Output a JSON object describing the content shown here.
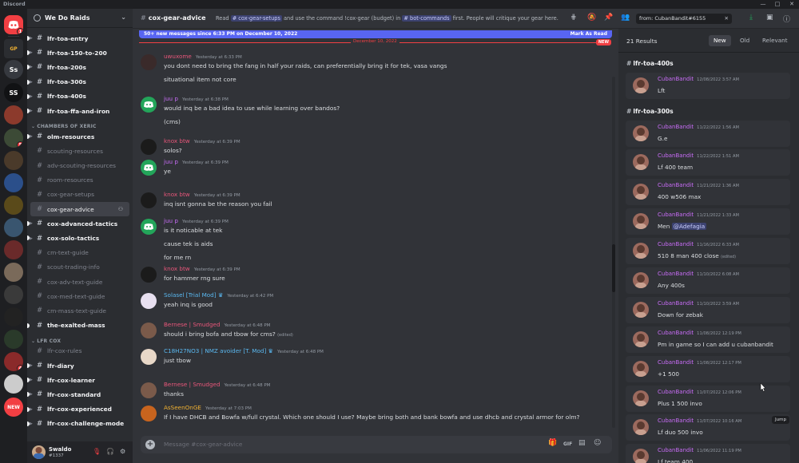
{
  "app": {
    "title": "Discord",
    "window_controls": [
      "—",
      "□",
      "✕"
    ]
  },
  "servers": [
    {
      "label": "",
      "icon": "discord-logo-icon",
      "color": "#f23f43",
      "badge": "1"
    },
    {
      "label": "GP",
      "icon": "gpower-icon",
      "color": "#2b2d31",
      "badge": ""
    },
    {
      "label": "Ss",
      "icon": "",
      "color": "#36393f",
      "badge": ""
    },
    {
      "label": "SS",
      "icon": "",
      "color": "#111214",
      "badge": ""
    },
    {
      "label": "",
      "icon": "",
      "color": "#8c3a2c",
      "badge": ""
    },
    {
      "label": "",
      "icon": "",
      "color": "#3c4a36",
      "badge": "5"
    },
    {
      "label": "",
      "icon": "",
      "color": "#4a3a2a",
      "badge": ""
    },
    {
      "label": "",
      "icon": "",
      "color": "#2b4f8a",
      "badge": ""
    },
    {
      "label": "",
      "icon": "",
      "color": "#5a4a1a",
      "badge": ""
    },
    {
      "label": "",
      "icon": "",
      "color": "#39556f",
      "badge": ""
    },
    {
      "label": "",
      "icon": "",
      "color": "#6a2a2a",
      "badge": ""
    },
    {
      "label": "",
      "icon": "",
      "color": "#7a6a5a",
      "badge": ""
    },
    {
      "label": "",
      "icon": "",
      "color": "#3a3a3a",
      "badge": ""
    },
    {
      "label": "",
      "icon": "",
      "color": "#222",
      "badge": ""
    },
    {
      "label": "",
      "icon": "",
      "color": "#2a3a2a",
      "badge": ""
    },
    {
      "label": "",
      "icon": "",
      "color": "#8a2a2a",
      "badge": "4"
    },
    {
      "label": "",
      "icon": "",
      "color": "#cccccc",
      "badge": ""
    },
    {
      "label": "NEW",
      "icon": "",
      "color": "#f23f43",
      "badge": ""
    }
  ],
  "guild": {
    "name": "We Do Raids"
  },
  "channels": [
    {
      "kind": "channel",
      "name": "lfr-toa-entry",
      "unread": true,
      "active": false,
      "thread": true
    },
    {
      "kind": "channel",
      "name": "lfr-toa-150-to-200",
      "unread": true,
      "active": false,
      "thread": true
    },
    {
      "kind": "channel",
      "name": "lfr-toa-200s",
      "unread": true,
      "active": false,
      "thread": true
    },
    {
      "kind": "channel",
      "name": "lfr-toa-300s",
      "unread": true,
      "active": false,
      "thread": true
    },
    {
      "kind": "channel",
      "name": "lfr-toa-400s",
      "unread": true,
      "active": false,
      "thread": true
    },
    {
      "kind": "channel",
      "name": "lfr-toa-ffa-and-iron",
      "unread": true,
      "active": false,
      "thread": true
    },
    {
      "kind": "category",
      "name": "CHAMBERS OF XERIC"
    },
    {
      "kind": "channel",
      "name": "olm-resources",
      "unread": true,
      "active": false,
      "thread": true
    },
    {
      "kind": "channel",
      "name": "scouting-resources",
      "unread": false,
      "active": false,
      "thread": false
    },
    {
      "kind": "channel",
      "name": "adv-scouting-resources",
      "unread": false,
      "active": false,
      "thread": false
    },
    {
      "kind": "channel",
      "name": "room-resources",
      "unread": false,
      "active": false,
      "thread": false
    },
    {
      "kind": "channel",
      "name": "cox-gear-setups",
      "unread": false,
      "active": false,
      "thread": false
    },
    {
      "kind": "channel",
      "name": "cox-gear-advice",
      "unread": false,
      "active": true,
      "thread": false
    },
    {
      "kind": "channel",
      "name": "cox-advanced-tactics",
      "unread": true,
      "active": false,
      "thread": true
    },
    {
      "kind": "channel",
      "name": "cox-solo-tactics",
      "unread": true,
      "active": false,
      "thread": true
    },
    {
      "kind": "channel",
      "name": "cm-text-guide",
      "unread": false,
      "active": false,
      "thread": false
    },
    {
      "kind": "channel",
      "name": "scout-trading-info",
      "unread": false,
      "active": false,
      "thread": false
    },
    {
      "kind": "channel",
      "name": "cox-adv-text-guide",
      "unread": false,
      "active": false,
      "thread": false
    },
    {
      "kind": "channel",
      "name": "cox-med-text-guide",
      "unread": false,
      "active": false,
      "thread": false
    },
    {
      "kind": "channel",
      "name": "cm-mass-text-guide",
      "unread": false,
      "active": false,
      "thread": false
    },
    {
      "kind": "channel",
      "name": "the-exalted-mass",
      "unread": true,
      "active": false,
      "thread": false
    },
    {
      "kind": "category",
      "name": "LFR COX"
    },
    {
      "kind": "channel",
      "name": "lfr-cox-rules",
      "unread": false,
      "active": false,
      "thread": false
    },
    {
      "kind": "channel",
      "name": "lfr-diary",
      "unread": true,
      "active": false,
      "thread": true
    },
    {
      "kind": "channel",
      "name": "lfr-cox-learner",
      "unread": true,
      "active": false,
      "thread": true
    },
    {
      "kind": "channel",
      "name": "lfr-cox-standard",
      "unread": true,
      "active": false,
      "thread": true
    },
    {
      "kind": "channel",
      "name": "lfr-cox-experienced",
      "unread": true,
      "active": false,
      "thread": true
    },
    {
      "kind": "channel",
      "name": "lfr-cox-challenge-mode",
      "unread": true,
      "active": false,
      "thread": true
    }
  ],
  "user": {
    "name": "Swaldo",
    "tag": "#1337"
  },
  "header": {
    "channel": "cox-gear-advice",
    "topic_pre": "Read",
    "topic_ch1": "# cox-gear-setups",
    "topic_mid": "and use the command !cox-gear (budget) in",
    "topic_ch2": "# bot-commands",
    "topic_post": "first. People will critique your gear here.",
    "search_value": "from: CubanBandit#6155"
  },
  "newbar": {
    "text": "50+ new messages since 6:33 PM on December 10, 2022",
    "action": "Mark As Read"
  },
  "date_sep": {
    "label": "December 10, 2022",
    "new_tag": "NEW"
  },
  "messages": [
    {
      "author": "uwuxome",
      "color": "#e8567a",
      "ts": "Yesterday at 6:33 PM",
      "avatar": "#3a2a2a",
      "lines": [
        "you dont need to bring the fang in half your raids, can preferentially bring it for tek, vasa vangs",
        "situational item not core"
      ],
      "edited": ""
    },
    {
      "author": "juu p",
      "color": "#c76cf5",
      "ts": "Yesterday at 6:38 PM",
      "avatar": "#23a55a",
      "lines": [
        "would inq be a bad idea to use while learning over bandos?",
        "(cms)"
      ],
      "edited": ""
    },
    {
      "author": "knox btw",
      "color": "#e8567a",
      "ts": "Yesterday at 6:39 PM",
      "avatar": "#1b1b1b",
      "lines": [
        "solos?"
      ],
      "edited": ""
    },
    {
      "author": "juu p",
      "color": "#c76cf5",
      "ts": "Yesterday at 6:39 PM",
      "avatar": "#23a55a",
      "lines": [
        "ye"
      ],
      "edited": ""
    },
    {
      "author": "knox btw",
      "color": "#e8567a",
      "ts": "Yesterday at 6:39 PM",
      "avatar": "#1b1b1b",
      "lines": [
        "inq isnt gonna be the reason you fail"
      ],
      "edited": ""
    },
    {
      "author": "juu p",
      "color": "#c76cf5",
      "ts": "Yesterday at 6:39 PM",
      "avatar": "#23a55a",
      "lines": [
        "is it noticable at tek",
        "cause tek is aids",
        "for me rn"
      ],
      "edited": ""
    },
    {
      "author": "knox btw",
      "color": "#e8567a",
      "ts": "Yesterday at 6:39 PM",
      "avatar": "#1b1b1b",
      "lines": [
        "for hammer rng sure"
      ],
      "edited": ""
    },
    {
      "author": "Solasel [Trial Mod]",
      "color": "#5ab8f0",
      "ts": "Yesterday at 6:42 PM",
      "avatar": "#e8e0f0",
      "lines": [
        "yeah inq is good"
      ],
      "edited": ""
    },
    {
      "author": "Bernese | Smudged",
      "color": "#e8567a",
      "ts": "Yesterday at 6:48 PM",
      "avatar": "#7a5a4a",
      "lines": [
        "should i bring bofa and tbow for cms?"
      ],
      "edited": "(edited)"
    },
    {
      "author": "C18H27NO3 | NMZ avoider [T. Mod]",
      "color": "#5ab8f0",
      "ts": "Yesterday at 6:48 PM",
      "avatar": "#e8d8c8",
      "lines": [
        "just tbow"
      ],
      "edited": ""
    },
    {
      "author": "Bernese | Smudged",
      "color": "#e8567a",
      "ts": "Yesterday at 6:48 PM",
      "avatar": "#7a5a4a",
      "lines": [
        "thanks"
      ],
      "edited": ""
    },
    {
      "author": "AsSeenOnGE",
      "color": "#f0b132",
      "ts": "Yesterday at 7:03 PM",
      "avatar": "#c8641e",
      "lines": [
        "If I have DHCB and Bowfa w/full crystal. Which one should I use?  Maybe bring both and bank bowfa and use dhcb and crystal armor for olm?"
      ],
      "edited": ""
    }
  ],
  "composer": {
    "placeholder": "Message #cox-gear-advice"
  },
  "results": {
    "count": "21 Results",
    "tabs": [
      "New",
      "Old",
      "Relevant"
    ],
    "jump": "Jump",
    "groups": [
      {
        "channel": "lfr-toa-400s",
        "items": [
          {
            "author": "CubanBandit",
            "ts": "12/08/2022 3:57 AM",
            "text": "Lft",
            "mention": "",
            "edited": ""
          }
        ]
      },
      {
        "channel": "lfr-toa-300s",
        "items": [
          {
            "author": "CubanBandit",
            "ts": "11/22/2022 1:56 AM",
            "text": "G.e",
            "mention": "",
            "edited": ""
          },
          {
            "author": "CubanBandit",
            "ts": "11/22/2022 1:51 AM",
            "text": "Lf 400 team",
            "mention": "",
            "edited": ""
          },
          {
            "author": "CubanBandit",
            "ts": "11/21/2022 1:36 AM",
            "text": "400 w506 max",
            "mention": "",
            "edited": ""
          },
          {
            "author": "CubanBandit",
            "ts": "11/21/2022 1:33 AM",
            "text": "Men",
            "mention": "@Adefagia",
            "edited": ""
          },
          {
            "author": "CubanBandit",
            "ts": "11/16/2022 6:33 AM",
            "text": "510 8 man 400 close",
            "mention": "",
            "edited": "(edited)"
          },
          {
            "author": "CubanBandit",
            "ts": "11/10/2022 6:08 AM",
            "text": "Any 400s",
            "mention": "",
            "edited": ""
          },
          {
            "author": "CubanBandit",
            "ts": "11/10/2022 3:59 AM",
            "text": "Down for zebak",
            "mention": "",
            "edited": ""
          },
          {
            "author": "CubanBandit",
            "ts": "11/08/2022 12:19 PM",
            "text": "Pm in game so I can add u cubanbandit",
            "mention": "",
            "edited": ""
          },
          {
            "author": "CubanBandit",
            "ts": "11/08/2022 12:17 PM",
            "text": "+1 500",
            "mention": "",
            "edited": ""
          },
          {
            "author": "CubanBandit",
            "ts": "11/07/2022 12:06 PM",
            "text": "Plus 1 500 invo",
            "mention": "",
            "edited": ""
          },
          {
            "author": "CubanBandit",
            "ts": "11/07/2022 10:16 AM",
            "text": "Lf duo 500 invo",
            "mention": "",
            "edited": ""
          },
          {
            "author": "CubanBandit",
            "ts": "11/06/2022 11:19 PM",
            "text": "Lf team 400",
            "mention": "",
            "edited": ""
          }
        ]
      }
    ]
  }
}
